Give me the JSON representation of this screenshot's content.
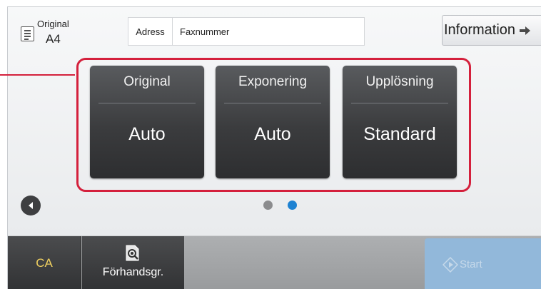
{
  "original": {
    "label": "Original",
    "size": "A4",
    "icon": "document-icon"
  },
  "address": {
    "label": "Adress",
    "placeholder": "Faxnummer"
  },
  "info_button": {
    "label": "Information",
    "icon": "arrow-right-icon"
  },
  "settings": [
    {
      "title": "Original",
      "value": "Auto"
    },
    {
      "title": "Exponering",
      "value": "Auto"
    },
    {
      "title": "Upplösning",
      "value": "Standard"
    }
  ],
  "pagination": {
    "pages": 2,
    "current": 2
  },
  "bottom": {
    "ca_label": "CA",
    "preview_label": "Förhandsgr.",
    "start_label": "Start"
  },
  "colors": {
    "highlight": "#d4203c",
    "active_dot": "#1e82d2",
    "ca_text": "#f0d060",
    "start_bg": "#92b8da"
  }
}
